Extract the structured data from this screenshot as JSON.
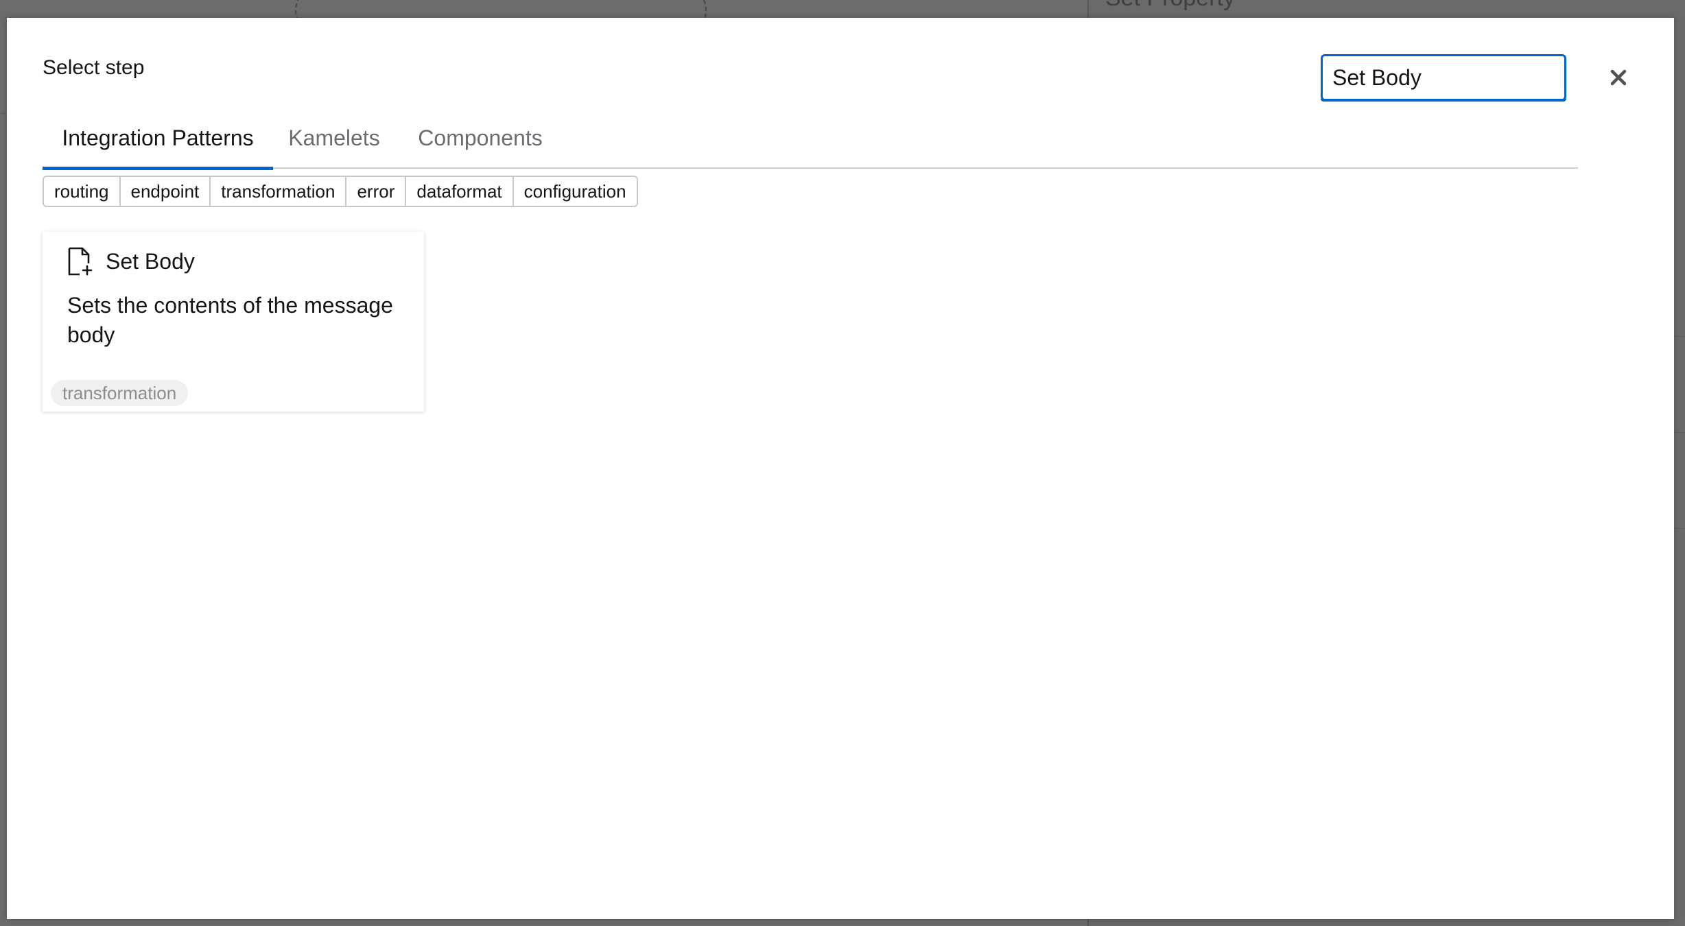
{
  "background": {
    "panel_title": "Set Property"
  },
  "modal": {
    "title": "Select step",
    "search": {
      "value": "Set Body",
      "icon": "close-icon"
    },
    "tabs": [
      {
        "label": "Integration Patterns",
        "active": true
      },
      {
        "label": "Kamelets",
        "active": false
      },
      {
        "label": "Components",
        "active": false
      }
    ],
    "filters": [
      "routing",
      "endpoint",
      "transformation",
      "error",
      "dataformat",
      "configuration"
    ],
    "results": [
      {
        "icon": "file-add-icon",
        "title": "Set Body",
        "description": "Sets the contents of the message body",
        "tag": "transformation"
      }
    ]
  },
  "colors": {
    "accent": "#0066cc",
    "text": "#151515",
    "muted": "#6a6e73",
    "overlay": "#6a6a6a"
  }
}
